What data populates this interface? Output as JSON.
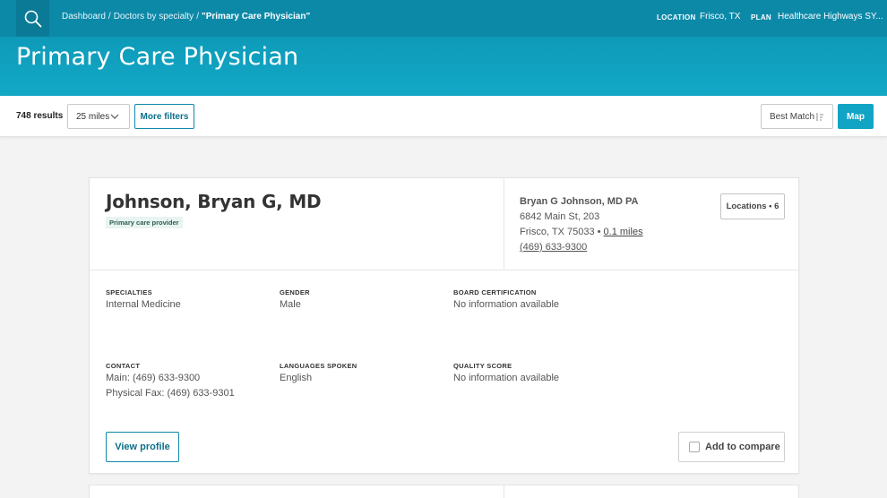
{
  "topbar": {
    "breadcrumb": {
      "dashboard": "Dashboard",
      "doctors_by_specialty": "Doctors by specialty",
      "current": "\"Primary Care Physician\"",
      "separator": "/"
    },
    "location_label": "LOCATION",
    "location_value": "Frisco, TX",
    "plan_label": "PLAN",
    "plan_value": "Healthcare Highways SY..."
  },
  "hero": {
    "title": "Primary Care Physician"
  },
  "filters": {
    "results": "748 results",
    "distance": "25 miles",
    "more_filters": "More filters",
    "sort": "Best Match",
    "map": "Map"
  },
  "card": {
    "doctor_name": "Johnson, Bryan G, MD",
    "badge": "Primary care provider",
    "practice_name": "Bryan G Johnson, MD PA",
    "address_line1": "6842 Main St, 203",
    "city_state_zip": "Frisco, TX 75033",
    "bullet": "•",
    "distance": "0.1 miles",
    "phone": "(469) 633-9300",
    "locations_button": "Locations • 6",
    "fields": {
      "specialties_label": "SPECIALTIES",
      "specialties_value": "Internal Medicine",
      "gender_label": "GENDER",
      "gender_value": "Male",
      "board_label": "BOARD CERTIFICATION",
      "board_value": "No information available",
      "contact_label": "CONTACT",
      "contact_main": "Main: (469) 633-9300",
      "contact_fax": "Physical Fax: (469) 633-9301",
      "languages_label": "LANGUAGES SPOKEN",
      "languages_value": "English",
      "quality_label": "QUALITY SCORE",
      "quality_value": "No information available"
    },
    "view_profile": "View profile",
    "add_to_compare": "Add to compare"
  },
  "colors": {
    "topbar": "#0d89a8",
    "hero": "#12a9c6",
    "accent": "#0d89a8",
    "map_button": "#12a4c4"
  },
  "icons": {
    "search": "search-icon",
    "dropdown": "chevron-down-icon",
    "sort": "sort-icon",
    "compare": "checkbox-icon"
  }
}
